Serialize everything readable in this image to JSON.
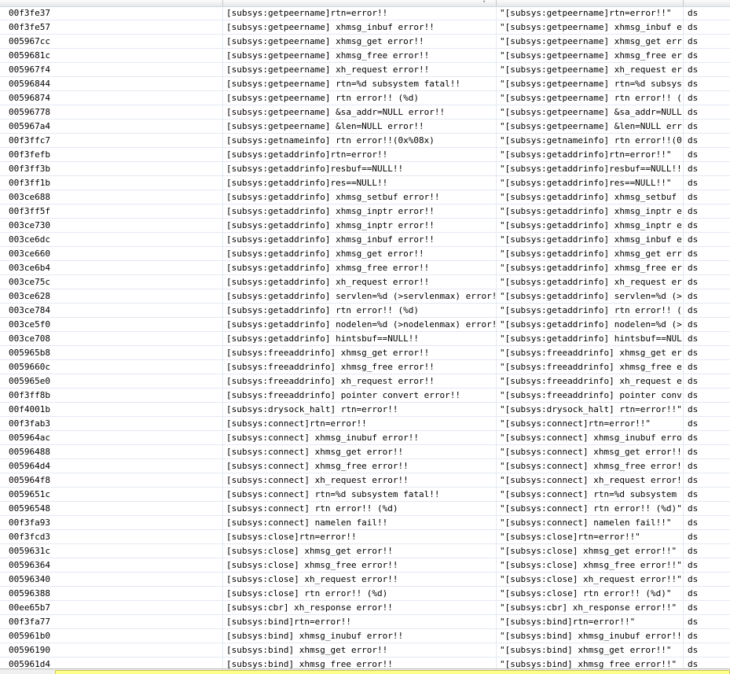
{
  "columns": {
    "address": "",
    "string_value": "",
    "string_representation": "",
    "data_type": ""
  },
  "rows": [
    {
      "address": "00f3fe37",
      "value": "[subsys:getpeername]rtn=error!!",
      "repr": "\"[subsys:getpeername]rtn=error!!\"",
      "type": "ds"
    },
    {
      "address": "00f3fe57",
      "value": "[subsys:getpeername] xhmsg_inbuf error!!",
      "repr": "\"[subsys:getpeername] xhmsg_inbuf e...",
      "type": "ds"
    },
    {
      "address": "005967cc",
      "value": "[subsys:getpeername] xhmsg_get error!!",
      "repr": "\"[subsys:getpeername] xhmsg_get err...",
      "type": "ds"
    },
    {
      "address": "0059681c",
      "value": "[subsys:getpeername] xhmsg_free error!!",
      "repr": "\"[subsys:getpeername] xhmsg_free er...",
      "type": "ds"
    },
    {
      "address": "005967f4",
      "value": "[subsys:getpeername] xh_request error!!",
      "repr": "\"[subsys:getpeername] xh_request er...",
      "type": "ds"
    },
    {
      "address": "00596844",
      "value": "[subsys:getpeername] rtn=%d subsystem fatal!!",
      "repr": "\"[subsys:getpeername] rtn=%d subsys...",
      "type": "ds"
    },
    {
      "address": "00596874",
      "value": "[subsys:getpeername] rtn error!! (%d)",
      "repr": "\"[subsys:getpeername] rtn error!! (...",
      "type": "ds"
    },
    {
      "address": "00596778",
      "value": "[subsys:getpeername] &sa_addr=NULL error!!",
      "repr": "\"[subsys:getpeername] &sa_addr=NULL...",
      "type": "ds"
    },
    {
      "address": "005967a4",
      "value": "[subsys:getpeername] &len=NULL error!!",
      "repr": "\"[subsys:getpeername] &len=NULL err...",
      "type": "ds"
    },
    {
      "address": "00f3ffc7",
      "value": "[subsys:getnameinfo] rtn error!!(0x%08x)",
      "repr": "\"[subsys:getnameinfo] rtn error!!(0...",
      "type": "ds"
    },
    {
      "address": "00f3fefb",
      "value": "[subsys:getaddrinfo]rtn=error!!",
      "repr": "\"[subsys:getaddrinfo]rtn=error!!\"",
      "type": "ds"
    },
    {
      "address": "00f3ff3b",
      "value": "[subsys:getaddrinfo]resbuf==NULL!!",
      "repr": "\"[subsys:getaddrinfo]resbuf==NULL!!\"",
      "type": "ds"
    },
    {
      "address": "00f3ff1b",
      "value": "[subsys:getaddrinfo]res==NULL!!",
      "repr": "\"[subsys:getaddrinfo]res==NULL!!\"",
      "type": "ds"
    },
    {
      "address": "003ce688",
      "value": "[subsys:getaddrinfo] xhmsg_setbuf error!!",
      "repr": "\"[subsys:getaddrinfo] xhmsg_setbuf ...",
      "type": "ds"
    },
    {
      "address": "00f3ff5f",
      "value": "[subsys:getaddrinfo] xhmsg_inptr error!!",
      "repr": "\"[subsys:getaddrinfo] xhmsg_inptr e...",
      "type": "ds"
    },
    {
      "address": "003ce730",
      "value": "[subsys:getaddrinfo] xhmsg_inptr error!!",
      "repr": "\"[subsys:getaddrinfo] xhmsg_inptr e...",
      "type": "ds"
    },
    {
      "address": "003ce6dc",
      "value": "[subsys:getaddrinfo] xhmsg_inbuf error!!",
      "repr": "\"[subsys:getaddrinfo] xhmsg_inbuf e...",
      "type": "ds"
    },
    {
      "address": "003ce660",
      "value": "[subsys:getaddrinfo] xhmsg_get error!!",
      "repr": "\"[subsys:getaddrinfo] xhmsg_get err...",
      "type": "ds"
    },
    {
      "address": "003ce6b4",
      "value": "[subsys:getaddrinfo] xhmsg_free error!!",
      "repr": "\"[subsys:getaddrinfo] xhmsg_free er...",
      "type": "ds"
    },
    {
      "address": "003ce75c",
      "value": "[subsys:getaddrinfo] xh_request error!!",
      "repr": "\"[subsys:getaddrinfo] xh_request er...",
      "type": "ds"
    },
    {
      "address": "003ce628",
      "value": "[subsys:getaddrinfo] servlen=%d (>servlenmax) error!!",
      "repr": "\"[subsys:getaddrinfo] servlen=%d (>...",
      "type": "ds"
    },
    {
      "address": "003ce784",
      "value": "[subsys:getaddrinfo] rtn error!! (%d)",
      "repr": "\"[subsys:getaddrinfo] rtn error!! (...",
      "type": "ds"
    },
    {
      "address": "003ce5f0",
      "value": "[subsys:getaddrinfo] nodelen=%d (>nodelenmax) error!!",
      "repr": "\"[subsys:getaddrinfo] nodelen=%d (>...",
      "type": "ds"
    },
    {
      "address": "003ce708",
      "value": "[subsys:getaddrinfo] hintsbuf==NULL!!",
      "repr": "\"[subsys:getaddrinfo] hintsbuf==NUL...",
      "type": "ds"
    },
    {
      "address": "005965b8",
      "value": "[subsys:freeaddrinfo] xhmsg_get error!!",
      "repr": "\"[subsys:freeaddrinfo] xhmsg_get er...",
      "type": "ds"
    },
    {
      "address": "0059660c",
      "value": "[subsys:freeaddrinfo] xhmsg_free error!!",
      "repr": "\"[subsys:freeaddrinfo] xhmsg_free e...",
      "type": "ds"
    },
    {
      "address": "005965e0",
      "value": "[subsys:freeaddrinfo] xh_request error!!",
      "repr": "\"[subsys:freeaddrinfo] xh_request e...",
      "type": "ds"
    },
    {
      "address": "00f3ff8b",
      "value": "[subsys:freeaddrinfo] pointer convert error!!",
      "repr": "\"[subsys:freeaddrinfo] pointer conv...",
      "type": "ds"
    },
    {
      "address": "00f4001b",
      "value": "[subsys:drysock_halt] rtn=error!!",
      "repr": "\"[subsys:drysock_halt] rtn=error!!\"",
      "type": "ds"
    },
    {
      "address": "00f3fab3",
      "value": "[subsys:connect]rtn=error!!",
      "repr": "\"[subsys:connect]rtn=error!!\"",
      "type": "ds"
    },
    {
      "address": "005964ac",
      "value": "[subsys:connect] xhmsg_inubuf error!!",
      "repr": "\"[subsys:connect] xhmsg_inubuf erro...",
      "type": "ds"
    },
    {
      "address": "00596488",
      "value": "[subsys:connect] xhmsg_get error!!",
      "repr": "\"[subsys:connect] xhmsg_get error!!\"",
      "type": "ds"
    },
    {
      "address": "005964d4",
      "value": "[subsys:connect] xhmsg_free error!!",
      "repr": "\"[subsys:connect] xhmsg_free error!!\"",
      "type": "ds"
    },
    {
      "address": "005964f8",
      "value": "[subsys:connect] xh_request error!!",
      "repr": "\"[subsys:connect] xh_request error!!\"",
      "type": "ds"
    },
    {
      "address": "0059651c",
      "value": "[subsys:connect] rtn=%d subsystem fatal!!",
      "repr": "\"[subsys:connect] rtn=%d subsystem ...",
      "type": "ds"
    },
    {
      "address": "00596548",
      "value": "[subsys:connect] rtn error!! (%d)",
      "repr": "\"[subsys:connect] rtn error!! (%d)\"",
      "type": "ds"
    },
    {
      "address": "00f3fa93",
      "value": "[subsys:connect] namelen fail!!",
      "repr": "\"[subsys:connect] namelen fail!!\"",
      "type": "ds"
    },
    {
      "address": "00f3fcd3",
      "value": "[subsys:close]rtn=error!!",
      "repr": "\"[subsys:close]rtn=error!!\"",
      "type": "ds"
    },
    {
      "address": "0059631c",
      "value": "[subsys:close] xhmsg_get error!!",
      "repr": "\"[subsys:close] xhmsg_get error!!\"",
      "type": "ds"
    },
    {
      "address": "00596364",
      "value": "[subsys:close] xhmsg_free error!!",
      "repr": "\"[subsys:close] xhmsg_free error!!\"",
      "type": "ds"
    },
    {
      "address": "00596340",
      "value": "[subsys:close] xh_request error!!",
      "repr": "\"[subsys:close] xh_request error!!\"",
      "type": "ds"
    },
    {
      "address": "00596388",
      "value": "[subsys:close] rtn error!! (%d)",
      "repr": "\"[subsys:close] rtn error!! (%d)\"",
      "type": "ds"
    },
    {
      "address": "00ee65b7",
      "value": "[subsys:cbr] xh_response error!!",
      "repr": "\"[subsys:cbr] xh_response error!!\"",
      "type": "ds"
    },
    {
      "address": "00f3fa77",
      "value": "[subsys:bind]rtn=error!!",
      "repr": "\"[subsys:bind]rtn=error!!\"",
      "type": "ds"
    },
    {
      "address": "005961b0",
      "value": "[subsys:bind] xhmsg_inubuf error!!",
      "repr": "\"[subsys:bind] xhmsg_inubuf error!!\"",
      "type": "ds"
    },
    {
      "address": "00596190",
      "value": "[subsys:bind] xhmsg_get error!!",
      "repr": "\"[subsys:bind] xhmsg_get error!!\"",
      "type": "ds"
    },
    {
      "address": "005961d4",
      "value": "[subsys:bind] xhmsg_free error!!",
      "repr": "\"[subsys:bind] xhmsg_free error!!\"",
      "type": "ds"
    }
  ],
  "filter": {
    "value": ""
  },
  "colors": {
    "row_divider": "#e3e9f2",
    "filter_background": "#ffff8c"
  }
}
